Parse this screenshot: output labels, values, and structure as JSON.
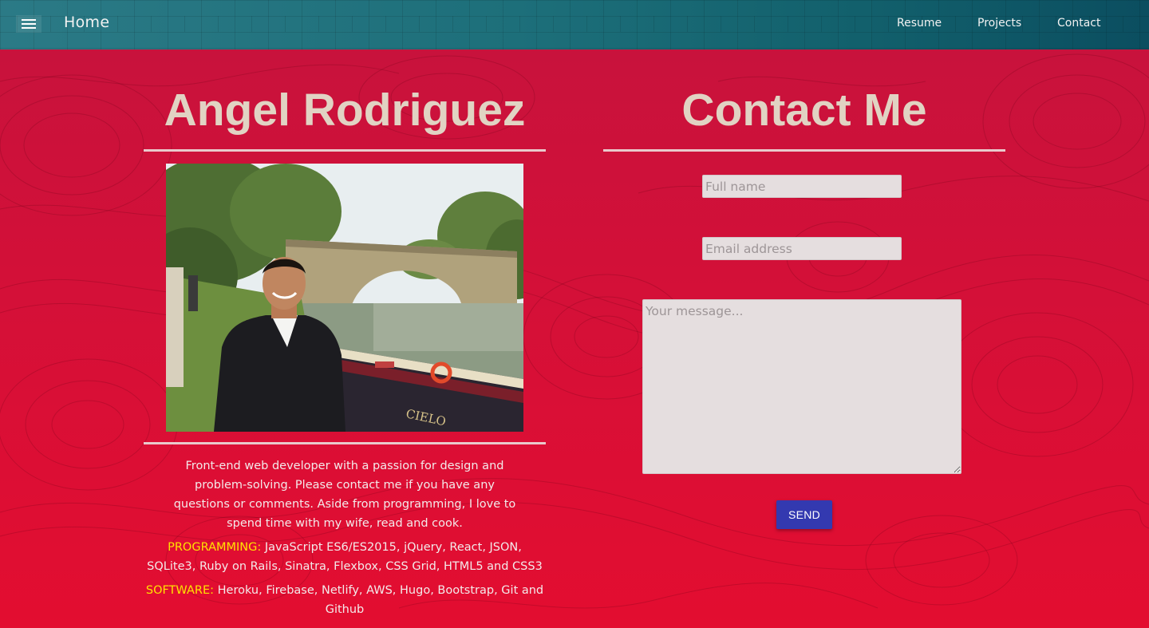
{
  "header": {
    "menu_icon": "hamburger-menu-icon",
    "home_label": "Home",
    "nav": [
      {
        "label": "Resume"
      },
      {
        "label": "Projects"
      },
      {
        "label": "Contact"
      }
    ]
  },
  "profile": {
    "name": "Angel Rodriguez",
    "bio": "Front-end web developer with a passion for design and problem-solving. Please contact me if you have any questions or comments. Aside from programming, I love to spend time with my wife, read and cook.",
    "programming_label": "PROGRAMMING:",
    "programming_text": "JavaScript ES6/ES2015, jQuery, React, JSON, SQLite3, Ruby on Rails, Sinatra, Flexbox, CSS Grid, HTML5 and CSS3",
    "software_label": "SOFTWARE:",
    "software_text": "Heroku, Firebase, Netlify, AWS, Hugo, Bootstrap, Git and Github"
  },
  "contact": {
    "title": "Contact Me",
    "name_placeholder": "Full name",
    "email_placeholder": "Email address",
    "message_placeholder": "Your message...",
    "send_label": "SEND"
  },
  "colors": {
    "header_teal": "#1d6f7a",
    "background_red": "#d3123a",
    "title_beige": "#e1d3c3",
    "skill_label_yellow": "#ffe100",
    "send_button_blue": "#3339b0",
    "input_bg": "#e5dedf"
  }
}
